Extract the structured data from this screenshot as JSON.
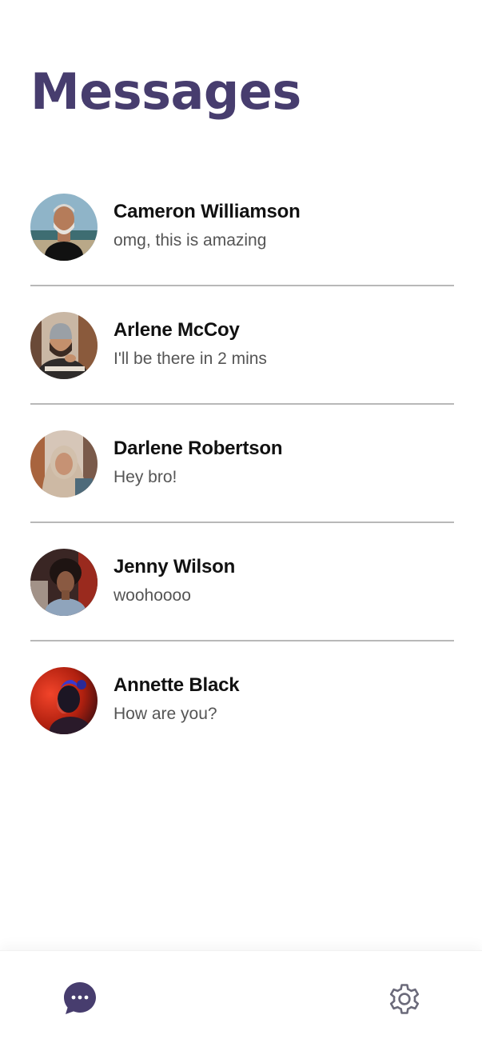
{
  "header": {
    "title": "Messages"
  },
  "conversations": [
    {
      "name": "Cameron Williamson",
      "last_message": "omg, this is amazing",
      "avatar": "avatar-photo-man-beard"
    },
    {
      "name": "Arlene McCoy",
      "last_message": "I'll be there in 2 mins",
      "avatar": "avatar-photo-man-beanie"
    },
    {
      "name": "Darlene Robertson",
      "last_message": "Hey bro!",
      "avatar": "avatar-photo-woman-hijab"
    },
    {
      "name": "Jenny Wilson",
      "last_message": "woohoooo",
      "avatar": "avatar-photo-woman-curly-hair"
    },
    {
      "name": "Annette Black",
      "last_message": "How are you?",
      "avatar": "avatar-photo-neon-portrait"
    }
  ],
  "bottom_nav": {
    "items": [
      {
        "icon": "chat-bubble-icon",
        "active": true
      },
      {
        "icon": "gear-icon",
        "active": false
      }
    ]
  },
  "colors": {
    "accent": "#473d6e",
    "divider": "#b8b8b8",
    "name_text": "#111111",
    "message_text": "#555555",
    "inactive_icon": "#6b6a7a"
  }
}
